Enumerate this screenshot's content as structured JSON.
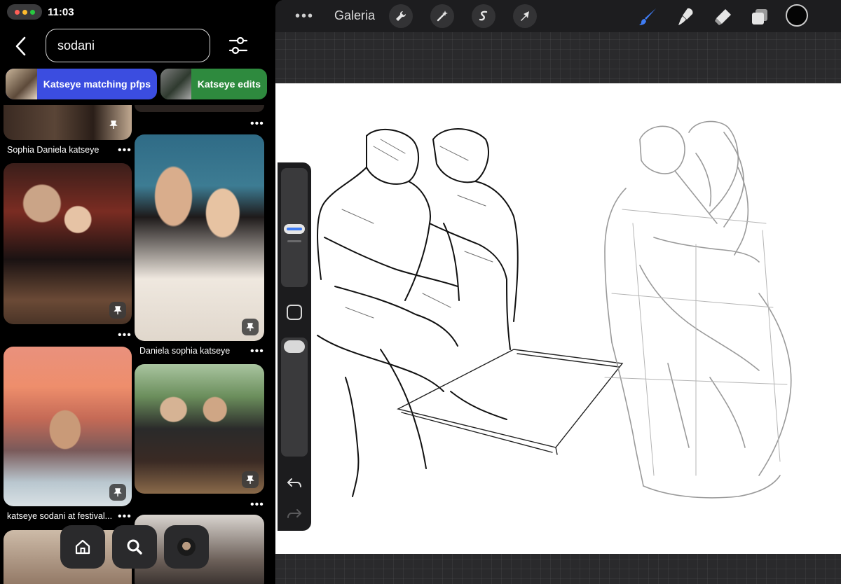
{
  "status_bar": {
    "time": "11:03",
    "dot_colors": [
      "#ff5f57",
      "#febc2e",
      "#28c840"
    ]
  },
  "search": {
    "value": "sodani"
  },
  "chips": [
    {
      "label": "Katseye matching pfps",
      "color": "#3b4de0"
    },
    {
      "label": "Katseye edits",
      "color": "#2e8a3e"
    }
  ],
  "pins": [
    {
      "caption": "Sophia Daniela katseye"
    },
    {
      "caption": "Daniela sophia katseye"
    },
    {
      "caption": "katseye sodani at festival..."
    }
  ],
  "more_label": "•••",
  "bottom_nav": [
    "home-icon",
    "search-icon",
    "profile-icon"
  ],
  "procreate": {
    "gallery_label": "Galeria",
    "menu_dots": "•••",
    "tools": [
      "wrench-icon",
      "magic-wand-icon",
      "selection-icon",
      "transform-arrow-icon"
    ],
    "brush_tools": [
      "brush-icon",
      "smudge-icon",
      "eraser-icon",
      "layers-icon"
    ],
    "accent": "#3f7cf3",
    "current_color": "#050505"
  }
}
